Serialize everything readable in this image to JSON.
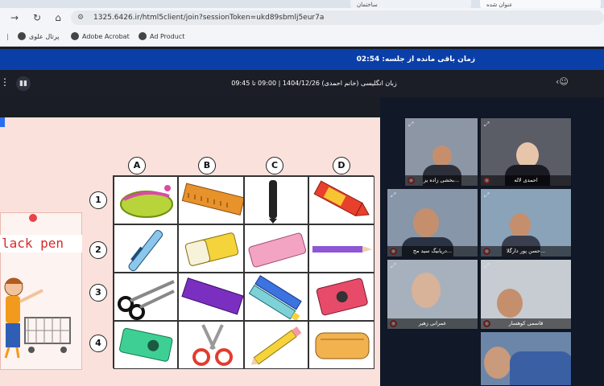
{
  "browser": {
    "tabs": [
      {
        "label": "ساختمان"
      },
      {
        "label": "عنوان شده"
      }
    ],
    "url": "1325.6426.ir/html5client/join?sessionToken=ukd89sbmlj5eur7a",
    "bookmarks": [
      {
        "label": "پرتال علوی"
      },
      {
        "label": "Adobe Acrobat"
      },
      {
        "label": "Ad Product"
      }
    ]
  },
  "session": {
    "timer_label": "زمان باقی مانده از جلسه:",
    "timer_value": "02:54",
    "title": "زبان انگلیسی (خانم احمدی) 1404/12/26 | 09:00 تا 09:45"
  },
  "slide": {
    "card_text": "lack pen",
    "columns": [
      "A",
      "B",
      "C",
      "D"
    ],
    "rows": [
      "1",
      "2",
      "3",
      "4"
    ],
    "items": [
      [
        "pencil-case",
        "ruler",
        "black-pen",
        "crayon"
      ],
      [
        "blue-pen",
        "eraser-yellow",
        "eraser-pink",
        "pencil-purple"
      ],
      [
        "scissors-black",
        "ruler-purple",
        "markers",
        "sharpener-red"
      ],
      [
        "sharpener-green",
        "scissors-red",
        "pencil-yellow",
        "pencil-case-orange"
      ]
    ]
  },
  "participants": [
    {
      "name": "بخشی زاده یز..."
    },
    {
      "name": "احمدی لاله"
    },
    {
      "name": "دریابیگ سید مح..."
    },
    {
      "name": "حسن پور دارگلا..."
    },
    {
      "name": "عمرانی زهیر"
    },
    {
      "name": "قاسمی کوهسار"
    },
    {
      "name": ""
    }
  ],
  "colors": {
    "timer_bar": "#0a3fa8",
    "slide_bg": "#fbe1dc",
    "card_text": "#d72a2a",
    "mic_muted": "#e53b3b"
  }
}
